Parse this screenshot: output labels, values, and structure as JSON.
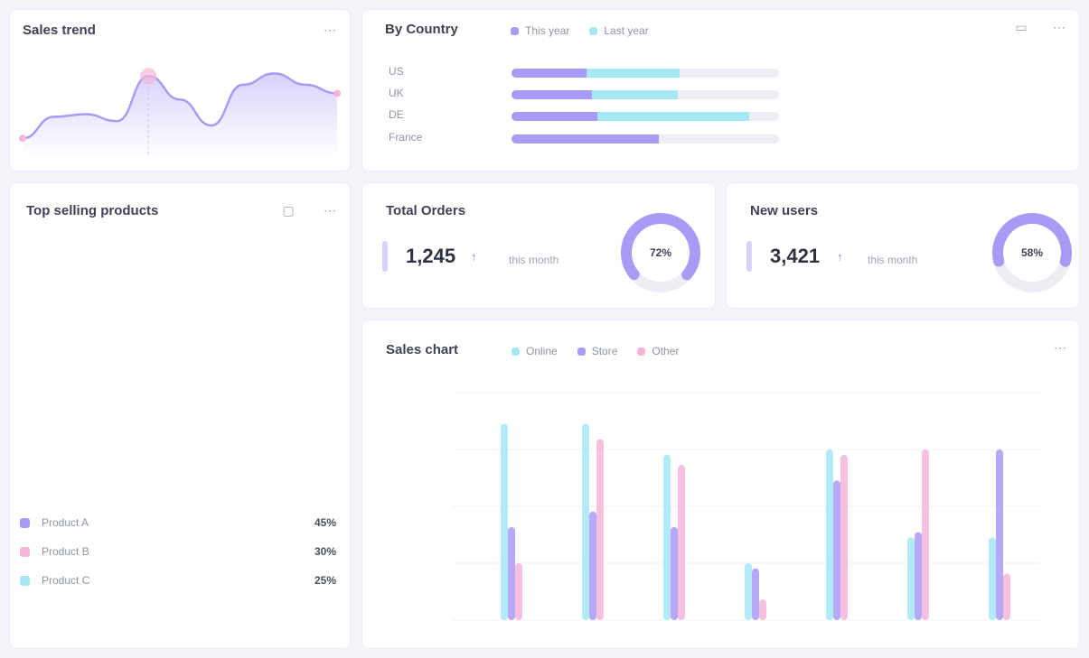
{
  "cards": {
    "sales_trend": {
      "title": "Sales trend",
      "menu_icon": "more-icon"
    },
    "by_country": {
      "title": "By Country",
      "legend": [
        {
          "label": "This year",
          "color": "#a99bf5"
        },
        {
          "label": "Last year",
          "color": "#a5e8f3"
        }
      ],
      "rows": [
        {
          "label": "US",
          "a": 0.28,
          "b": 0.35
        },
        {
          "label": "UK",
          "a": 0.3,
          "b": 0.32
        },
        {
          "label": "DE",
          "a": 0.32,
          "b": 0.57
        },
        {
          "label": "France",
          "a": 0.55,
          "b": 0.0
        }
      ],
      "icons": [
        "filter-icon",
        "more-icon"
      ]
    },
    "top_products": {
      "title": "Top selling products",
      "legend": [
        {
          "name": "Product A",
          "value": "45%",
          "color": "#a99bf5"
        },
        {
          "name": "Product B",
          "value": "30%",
          "color": "#f5b6d8"
        },
        {
          "name": "Product C",
          "value": "25%",
          "color": "#a5e8f3"
        }
      ]
    },
    "total_orders": {
      "title": "Total Orders",
      "value": "1,245",
      "trend": "↑",
      "sub": "this month",
      "donut_pct": 0.72,
      "donut_label": "72%"
    },
    "new_users": {
      "title": "New users",
      "value": "3,421",
      "trend": "↑",
      "sub": "this month",
      "donut_pct": 0.58,
      "donut_label": "58%"
    },
    "sales_chart": {
      "title": "Sales chart",
      "menu_icon": "more-icon"
    }
  },
  "chart_data": {
    "type": "bar",
    "categories": [
      "",
      "",
      "",
      "",
      "",
      "",
      ""
    ],
    "series": [
      {
        "name": "Online",
        "color": "#a5e8f3",
        "values": [
          190,
          190,
          160,
          55,
          165,
          80,
          80
        ]
      },
      {
        "name": "Store",
        "color": "#a99bf5",
        "values": [
          90,
          105,
          90,
          50,
          135,
          85,
          165
        ]
      },
      {
        "name": "Other",
        "color": "#f5b6d8",
        "values": [
          55,
          175,
          150,
          20,
          160,
          165,
          45
        ]
      }
    ],
    "ylim": [
      0,
      220
    ]
  },
  "trend_data": {
    "type": "area",
    "values": [
      10,
      35,
      38,
      30,
      82,
      55,
      25,
      72,
      85,
      72,
      62
    ]
  }
}
